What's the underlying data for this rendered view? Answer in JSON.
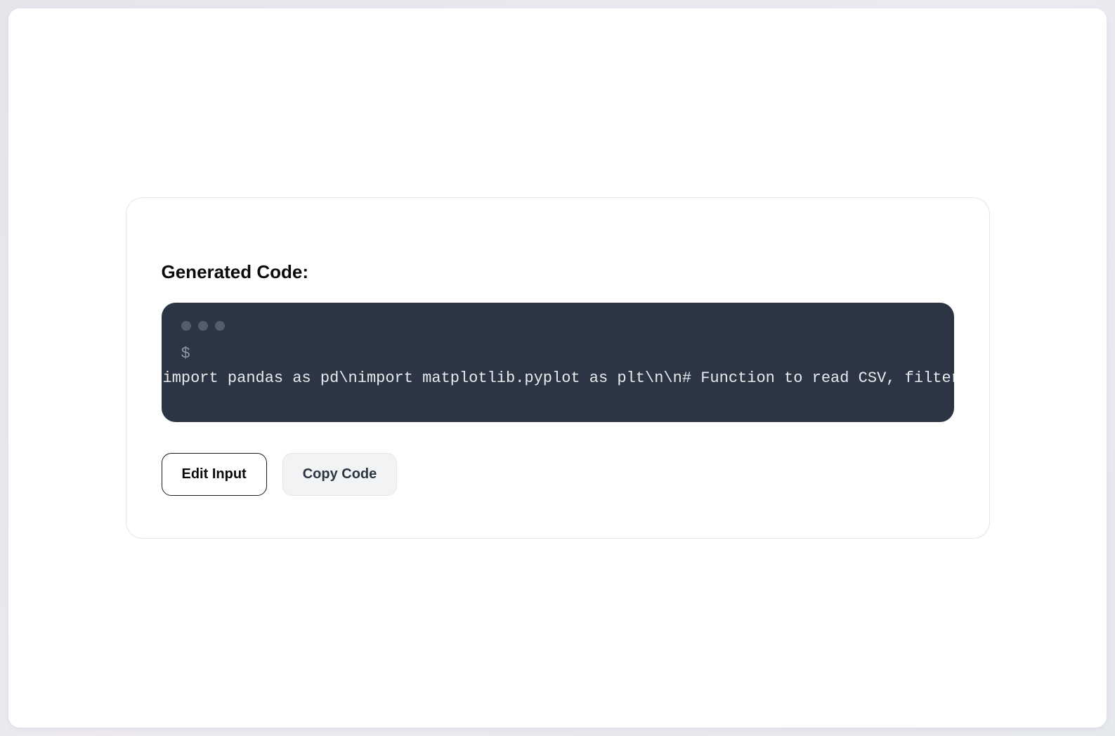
{
  "card": {
    "heading": "Generated Code:"
  },
  "terminal": {
    "prompt": "$",
    "code": "import pandas as pd\\nimport matplotlib.pyplot as plt\\n\\n# Function to read CSV, filter data, an"
  },
  "buttons": {
    "edit_input": "Edit Input",
    "copy_code": "Copy Code"
  }
}
